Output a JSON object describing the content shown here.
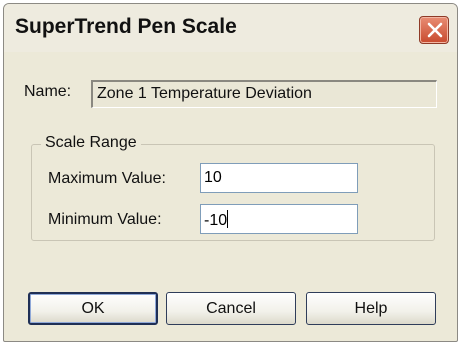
{
  "window": {
    "title": "SuperTrend Pen Scale",
    "close_icon": "close-icon"
  },
  "name": {
    "label": "Name:",
    "value": "Zone 1 Temperature Deviation"
  },
  "scale_range": {
    "caption": "Scale Range",
    "maximum_label": "Maximum Value:",
    "maximum_value": "10",
    "minimum_label": "Minimum Value:",
    "minimum_value": "-10"
  },
  "buttons": {
    "ok": "OK",
    "cancel": "Cancel",
    "help": "Help"
  },
  "colors": {
    "dialog_face": "#ece9d8",
    "close_button": "#c84a2e",
    "input_border": "#7f9db9"
  }
}
